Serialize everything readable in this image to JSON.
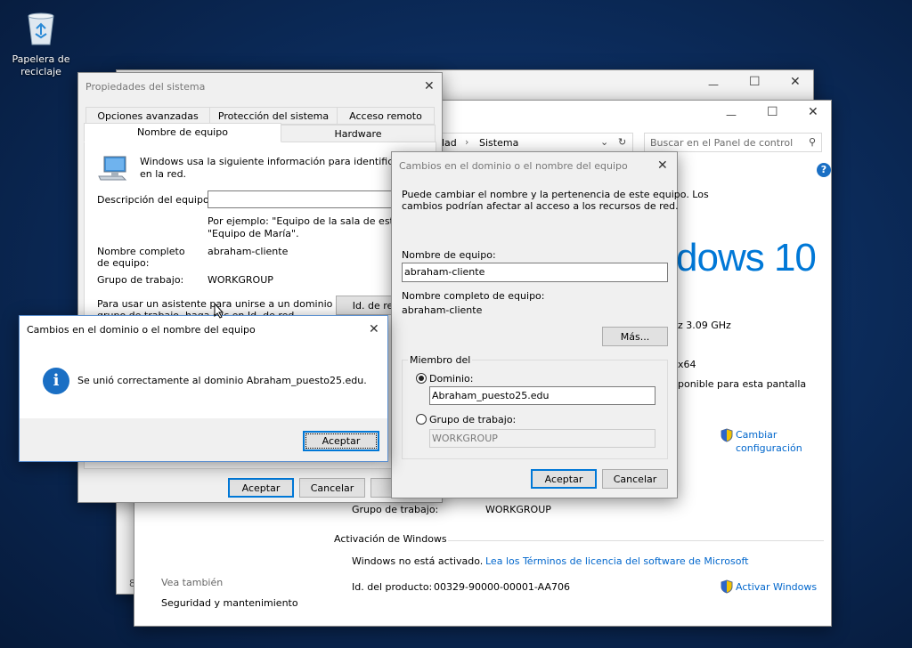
{
  "desktop": {
    "recycle_bin": {
      "line1": "Papelera de",
      "line2": "reciclaje"
    }
  },
  "system_window": {
    "breadcrumb_tail": "dad",
    "breadcrumb_current": "Sistema",
    "search_placeholder": "Buscar en el Panel de control",
    "windows_logo_text": "dows 10",
    "cpu_speed_fragment": "z  3.09 GHz",
    "x64_fragment": "x64",
    "touch_fragment": "ponible para esta pantalla",
    "change_settings_line1": "Cambiar",
    "change_settings_line2": "configuración",
    "workgroup_label": "Grupo de trabajo:",
    "workgroup_value": "WORKGROUP",
    "activation_heading": "Activación de Windows",
    "activation_status": "Windows no está activado.",
    "license_link": "Lea los Términos de licencia del software de Microsoft",
    "product_id_label": "Id. del producto:",
    "product_id_value": "00329-90000-00001-AA706",
    "activate_link": "Activar Windows",
    "see_also": "Vea también",
    "security_link": "Seguridad y mantenimiento",
    "edge_number": "8"
  },
  "sys_props": {
    "title": "Propiedades del sistema",
    "tabs_top": [
      "Opciones avanzadas",
      "Protección del sistema",
      "Acceso remoto"
    ],
    "tabs_bottom": [
      "Nombre de equipo",
      "Hardware"
    ],
    "intro_line1": "Windows usa la siguiente información para identificar su equ",
    "intro_line2": "en la red.",
    "description_label": "Descripción del equipo:",
    "example_line1": "Por ejemplo: \"Equipo de la sala de estar\" o",
    "example_line2": "\"Equipo de María\".",
    "fullname_label_line1": "Nombre completo",
    "fullname_label_line2": "de equipo:",
    "fullname_value": "abraham-cliente",
    "workgroup_label": "Grupo de trabajo:",
    "workgroup_value": "WORKGROUP",
    "wizard_line1": "Para usar un asistente para unirse a un dominio o",
    "wizard_line2": "grupo de trabajo, haga clic en Id. de red.",
    "network_id_button": "Id. de red",
    "ok_button": "Aceptar",
    "cancel_button": "Cancelar"
  },
  "domain_changes": {
    "title": "Cambios en el dominio o el nombre del equipo",
    "intro_line1": "Puede cambiar el nombre y la pertenencia de este equipo. Los",
    "intro_line2": "cambios podrían afectar al acceso a los recursos de red.",
    "computer_name_label": "Nombre de equipo:",
    "computer_name_value": "abraham-cliente",
    "fullname_label": "Nombre completo de equipo:",
    "fullname_value": "abraham-cliente",
    "more_button": "Más...",
    "member_of_label": "Miembro del",
    "domain_radio_label": "Dominio:",
    "domain_value": "Abraham_puesto25.edu",
    "workgroup_radio_label": "Grupo de trabajo:",
    "workgroup_value": "WORKGROUP",
    "ok_button": "Aceptar",
    "cancel_button": "Cancelar"
  },
  "message_box": {
    "title": "Cambios en el dominio o el nombre del equipo",
    "message": "Se unió correctamente al dominio Abraham_puesto25.edu.",
    "ok_button": "Aceptar"
  },
  "colors": {
    "accent": "#0078d7",
    "link": "#0066cc",
    "info_icon": "#1a6fc4"
  }
}
